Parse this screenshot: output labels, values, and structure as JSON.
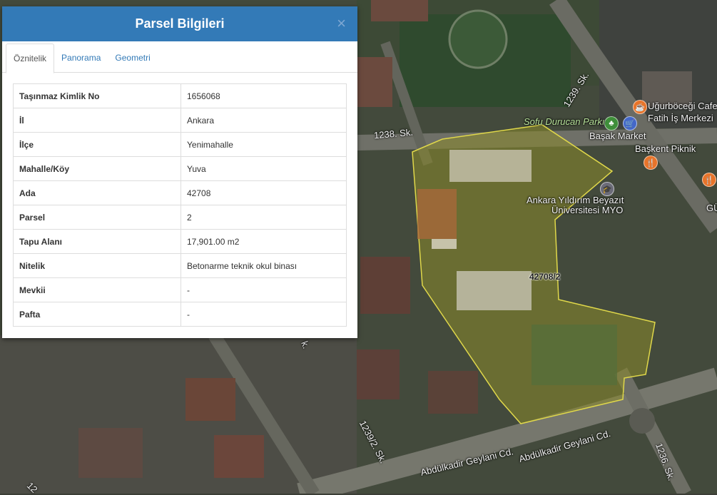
{
  "panel": {
    "title": "Parsel Bilgileri",
    "close_symbol": "×",
    "tabs": [
      {
        "label": "Öznitelik",
        "active": true
      },
      {
        "label": "Panorama",
        "active": false
      },
      {
        "label": "Geometri",
        "active": false
      }
    ],
    "rows": [
      {
        "key": "Taşınmaz Kimlik No",
        "value": "1656068"
      },
      {
        "key": "İl",
        "value": "Ankara"
      },
      {
        "key": "İlçe",
        "value": "Yenimahalle"
      },
      {
        "key": "Mahalle/Köy",
        "value": "Yuva"
      },
      {
        "key": "Ada",
        "value": "42708"
      },
      {
        "key": "Parsel",
        "value": "2"
      },
      {
        "key": "Tapu Alanı",
        "value": "17,901.00 m2"
      },
      {
        "key": "Nitelik",
        "value": "Betonarme teknik okul binası"
      },
      {
        "key": "Mevkii",
        "value": "-"
      },
      {
        "key": "Pafta",
        "value": "-"
      }
    ]
  },
  "map": {
    "parcel_label": "42708/2",
    "streets": {
      "s1239": "1239. Sk.",
      "s1238": "1238. Sk.",
      "s1239_2": "1239/2. Sk.",
      "s1236": "1236. Sk.",
      "geylani1": "Abdülkadir Geylani Cd.",
      "geylani2": "Abdülkadir Geylani Cd.",
      "partial_k": "k.",
      "partial_12": "12"
    },
    "pois": {
      "cafe": "Uğurböceği Cafe",
      "fatih": "Fatih İş Merkezi",
      "park": "Sofu Durucan Parkı",
      "market": "Başak Market",
      "piknik": "Başkent Piknik",
      "uni1": "Ankara Yıldırım Beyazıt",
      "uni2": "Üniversitesi MYO",
      "gu": "GÜ"
    },
    "colors": {
      "parcel_fill": "#8a8a2a",
      "parcel_stroke": "#e0d84a",
      "header": "#337ab7"
    }
  }
}
